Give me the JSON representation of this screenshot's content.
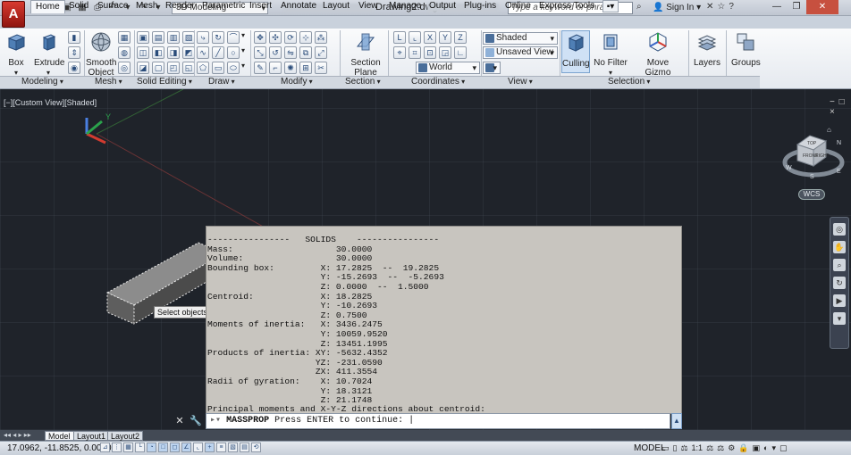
{
  "app": {
    "logo": "A",
    "workspace": "3D Modeling",
    "document_title": "Drawing2.dwg",
    "search_placeholder": "Type a keyword or phrase",
    "sign_in": "Sign In"
  },
  "tabs": [
    "Home",
    "Solid",
    "Surface",
    "Mesh",
    "Render",
    "Parametric",
    "Insert",
    "Annotate",
    "Layout",
    "View",
    "Manage",
    "Output",
    "Plug-ins",
    "Online",
    "Express Tools"
  ],
  "active_tab": "Home",
  "ribbon": {
    "big_buttons": {
      "box": "Box",
      "extrude": "Extrude",
      "smooth_1": "Smooth",
      "smooth_2": "Object",
      "section_1": "Section",
      "section_2": "Plane",
      "culling": "Culling",
      "no_filter": "No Filter",
      "move_gizmo": "Move Gizmo",
      "layers": "Layers",
      "groups": "Groups"
    },
    "combos": {
      "visual_style": "Shaded",
      "named_view": "Unsaved View",
      "ucs": "World"
    },
    "panels": {
      "modeling": "Modeling",
      "mesh": "Mesh",
      "solid_editing": "Solid Editing",
      "draw": "Draw",
      "modify": "Modify",
      "section": "Section",
      "coordinates": "Coordinates",
      "view": "View",
      "selection": "Selection"
    }
  },
  "viewport": {
    "label": "[−][Custom View][Shaded]",
    "controls": "− □ ×",
    "tooltip": "Select objects:",
    "wcs": "WCS",
    "viewcube_face": "FRONT",
    "viewcube_side": "RIGHT",
    "viewcube_top": "TOP",
    "compass": {
      "n": "N",
      "s": "S",
      "w": "W",
      "e": "E"
    },
    "axis_y": "Y"
  },
  "massprop": {
    "lines": [
      "----------------   SOLIDS    ----------------",
      "Mass:                    30.0000",
      "Volume:                  30.0000",
      "Bounding box:         X: 17.2825  --  19.2825",
      "                      Y: -15.2693  --  -5.2693",
      "                      Z: 0.0000  --  1.5000",
      "Centroid:             X: 18.2825",
      "                      Y: -10.2693",
      "                      Z: 0.7500",
      "Moments of inertia:   X: 3436.2475",
      "                      Y: 10059.9520",
      "                      Z: 13451.1995",
      "Products of inertia: XY: -5632.4352",
      "                     YZ: -231.0590",
      "                     ZX: 411.3554",
      "Radii of gyration:    X: 10.7024",
      "                      Y: 18.3121",
      "                      Z: 21.1748",
      "Principal moments and X-Y-Z directions about centroid:"
    ]
  },
  "command": {
    "name": "MASSPROP",
    "prompt": "Press ENTER to continue:",
    "cursor": "|"
  },
  "layouts": [
    "Model",
    "Layout1",
    "Layout2"
  ],
  "active_layout": "Model",
  "status": {
    "coordinates": "17.0962, -11.8525, 0.0000",
    "space": "MODEL",
    "scale": "1:1"
  }
}
